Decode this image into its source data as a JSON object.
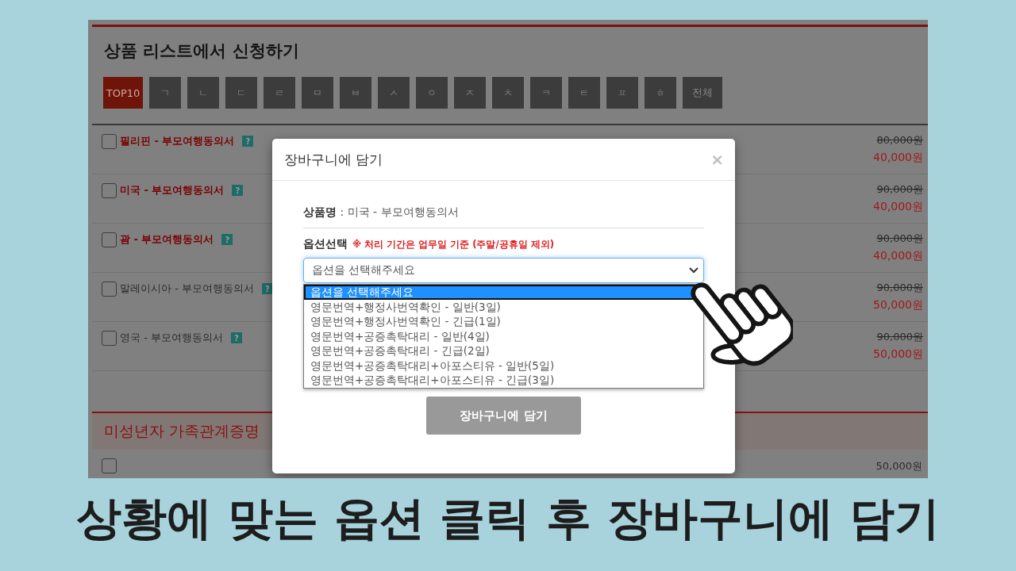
{
  "page": {
    "title": "상품 리스트에서 신청하기",
    "tabs": [
      {
        "label": "TOP10",
        "selected": true
      },
      {
        "label": "ㄱ",
        "selected": false
      },
      {
        "label": "ㄴ",
        "selected": false
      },
      {
        "label": "ㄷ",
        "selected": false
      },
      {
        "label": "ㄹ",
        "selected": false
      },
      {
        "label": "ㅁ",
        "selected": false
      },
      {
        "label": "ㅂ",
        "selected": false
      },
      {
        "label": "ㅅ",
        "selected": false
      },
      {
        "label": "ㅇ",
        "selected": false
      },
      {
        "label": "ㅈ",
        "selected": false
      },
      {
        "label": "ㅊ",
        "selected": false
      },
      {
        "label": "ㅋ",
        "selected": false
      },
      {
        "label": "ㅌ",
        "selected": false
      },
      {
        "label": "ㅍ",
        "selected": false
      },
      {
        "label": "ㅎ",
        "selected": false
      },
      {
        "label": "전체",
        "selected": false
      }
    ],
    "rows": [
      {
        "name": "필리핀 - 부모여행동의서",
        "featured": true,
        "checked": false,
        "help": "?",
        "price": "80,000원",
        "sale_price": "40,000원"
      },
      {
        "name": "미국 - 부모여행동의서",
        "featured": true,
        "checked": false,
        "help": "?",
        "price": "90,000원",
        "sale_price": "40,000원"
      },
      {
        "name": "괌 - 부모여행동의서",
        "featured": true,
        "checked": false,
        "help": "?",
        "price": "90,000원",
        "sale_price": "40,000원"
      },
      {
        "name": "말레이시아 - 부모여행동의서",
        "featured": false,
        "checked": false,
        "help": "?",
        "price": "90,000원",
        "sale_price": "50,000원"
      },
      {
        "name": "영국 - 부모여행동의서",
        "featured": false,
        "checked": false,
        "help": "?",
        "price": "90,000원",
        "sale_price": "50,000원"
      }
    ],
    "section": {
      "title": "미성년자 가족관계증명",
      "checked": false,
      "price": "50,000원"
    }
  },
  "modal": {
    "title": "장바구니에 담기",
    "close": "×",
    "product": "**상품명** : 미국 - 부모여행동의서",
    "option_label": "옵션선택",
    "option_note": "※ 처리 기간은 업무일 기준 (주말/공휴일 제외)",
    "select": {
      "value": "옵션을 선택해주세요",
      "expanded": true,
      "options": [
        {
          "label": "옵션을 선택해주세요",
          "selected": true
        },
        {
          "label": "영문번역+행정사번역확인 - 일반(3일)",
          "selected": false
        },
        {
          "label": "영문번역+행정사번역확인 - 긴급(1일)",
          "selected": false
        },
        {
          "label": "영문번역+공증촉탁대리 - 일반(4일)",
          "selected": false
        },
        {
          "label": "영문번역+공증촉탁대리 - 긴급(2일)",
          "selected": false
        },
        {
          "label": "영문번역+공증촉탁대리+아포스티유 - 일반(5일)",
          "selected": false
        },
        {
          "label": "영문번역+공증촉탁대리+아포스티유 - 긴급(3일)",
          "selected": false
        }
      ]
    },
    "submit": "장바구니에 담기"
  },
  "caption": "상황에 맞는 옵션 클릭 후 장바구니에 담기"
}
